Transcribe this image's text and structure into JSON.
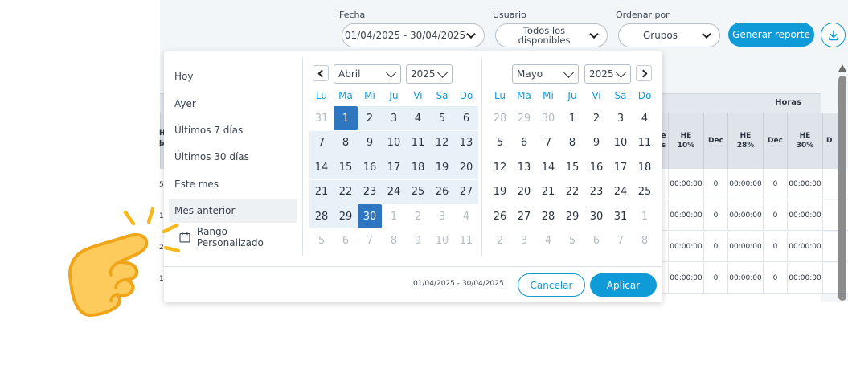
{
  "filters": {
    "fecha_label": "Fecha",
    "fecha_value": "01/04/2025 - 30/04/2025",
    "usuario_label": "Usuario",
    "usuario_value_line1": "Todos los",
    "usuario_value_line2": "disponibles",
    "ordenar_label": "Ordenar por",
    "ordenar_value": "Grupos",
    "generate_label": "Generar reporte"
  },
  "table": {
    "group_header": "Horas",
    "partial_header_1": "H",
    "partial_header_2": "b",
    "partial_header_3": "e",
    "partial_header_4": "s",
    "columns": [
      "HE\n10%",
      "Dec",
      "HE\n28%",
      "Dec",
      "HE\n30%",
      "D"
    ],
    "row_values": [
      "00:00:00",
      "0",
      "00:00:00",
      "0",
      "00:00:00"
    ],
    "left_digits": [
      "5",
      "1",
      "2",
      "1"
    ]
  },
  "picker": {
    "presets": [
      "Hoy",
      "Ayer",
      "Últimos 7 días",
      "Últimos 30 días",
      "Este mes",
      "Mes anterior"
    ],
    "custom_label": "Rango Personalizado",
    "active_preset": "Mes anterior",
    "weekdays": [
      "Lu",
      "Ma",
      "Mi",
      "Ju",
      "Vi",
      "Sa",
      "Do"
    ],
    "left": {
      "month": "Abril",
      "year": "2025",
      "days": [
        "31",
        "1",
        "2",
        "3",
        "4",
        "5",
        "6",
        "7",
        "8",
        "9",
        "10",
        "11",
        "12",
        "13",
        "14",
        "15",
        "16",
        "17",
        "18",
        "19",
        "20",
        "21",
        "22",
        "23",
        "24",
        "25",
        "26",
        "27",
        "28",
        "29",
        "30",
        "1",
        "2",
        "3",
        "4",
        "5",
        "6",
        "7",
        "8",
        "9",
        "10",
        "11"
      ]
    },
    "right": {
      "month": "Mayo",
      "year": "2025",
      "days": [
        "28",
        "29",
        "30",
        "1",
        "2",
        "3",
        "4",
        "5",
        "6",
        "7",
        "8",
        "9",
        "10",
        "11",
        "12",
        "13",
        "14",
        "15",
        "16",
        "17",
        "18",
        "19",
        "20",
        "21",
        "22",
        "23",
        "24",
        "25",
        "26",
        "27",
        "28",
        "29",
        "30",
        "31",
        "1",
        "2",
        "3",
        "4",
        "5",
        "6",
        "7",
        "8"
      ]
    },
    "range_text": "01/04/2025 - 30/04/2025",
    "cancel_label": "Cancelar",
    "apply_label": "Aplicar"
  },
  "colors": {
    "accent": "#0e9bd8",
    "selected_day": "#2e76bf",
    "range_bg": "#e8f1f8",
    "hand": "#f6b81c"
  }
}
